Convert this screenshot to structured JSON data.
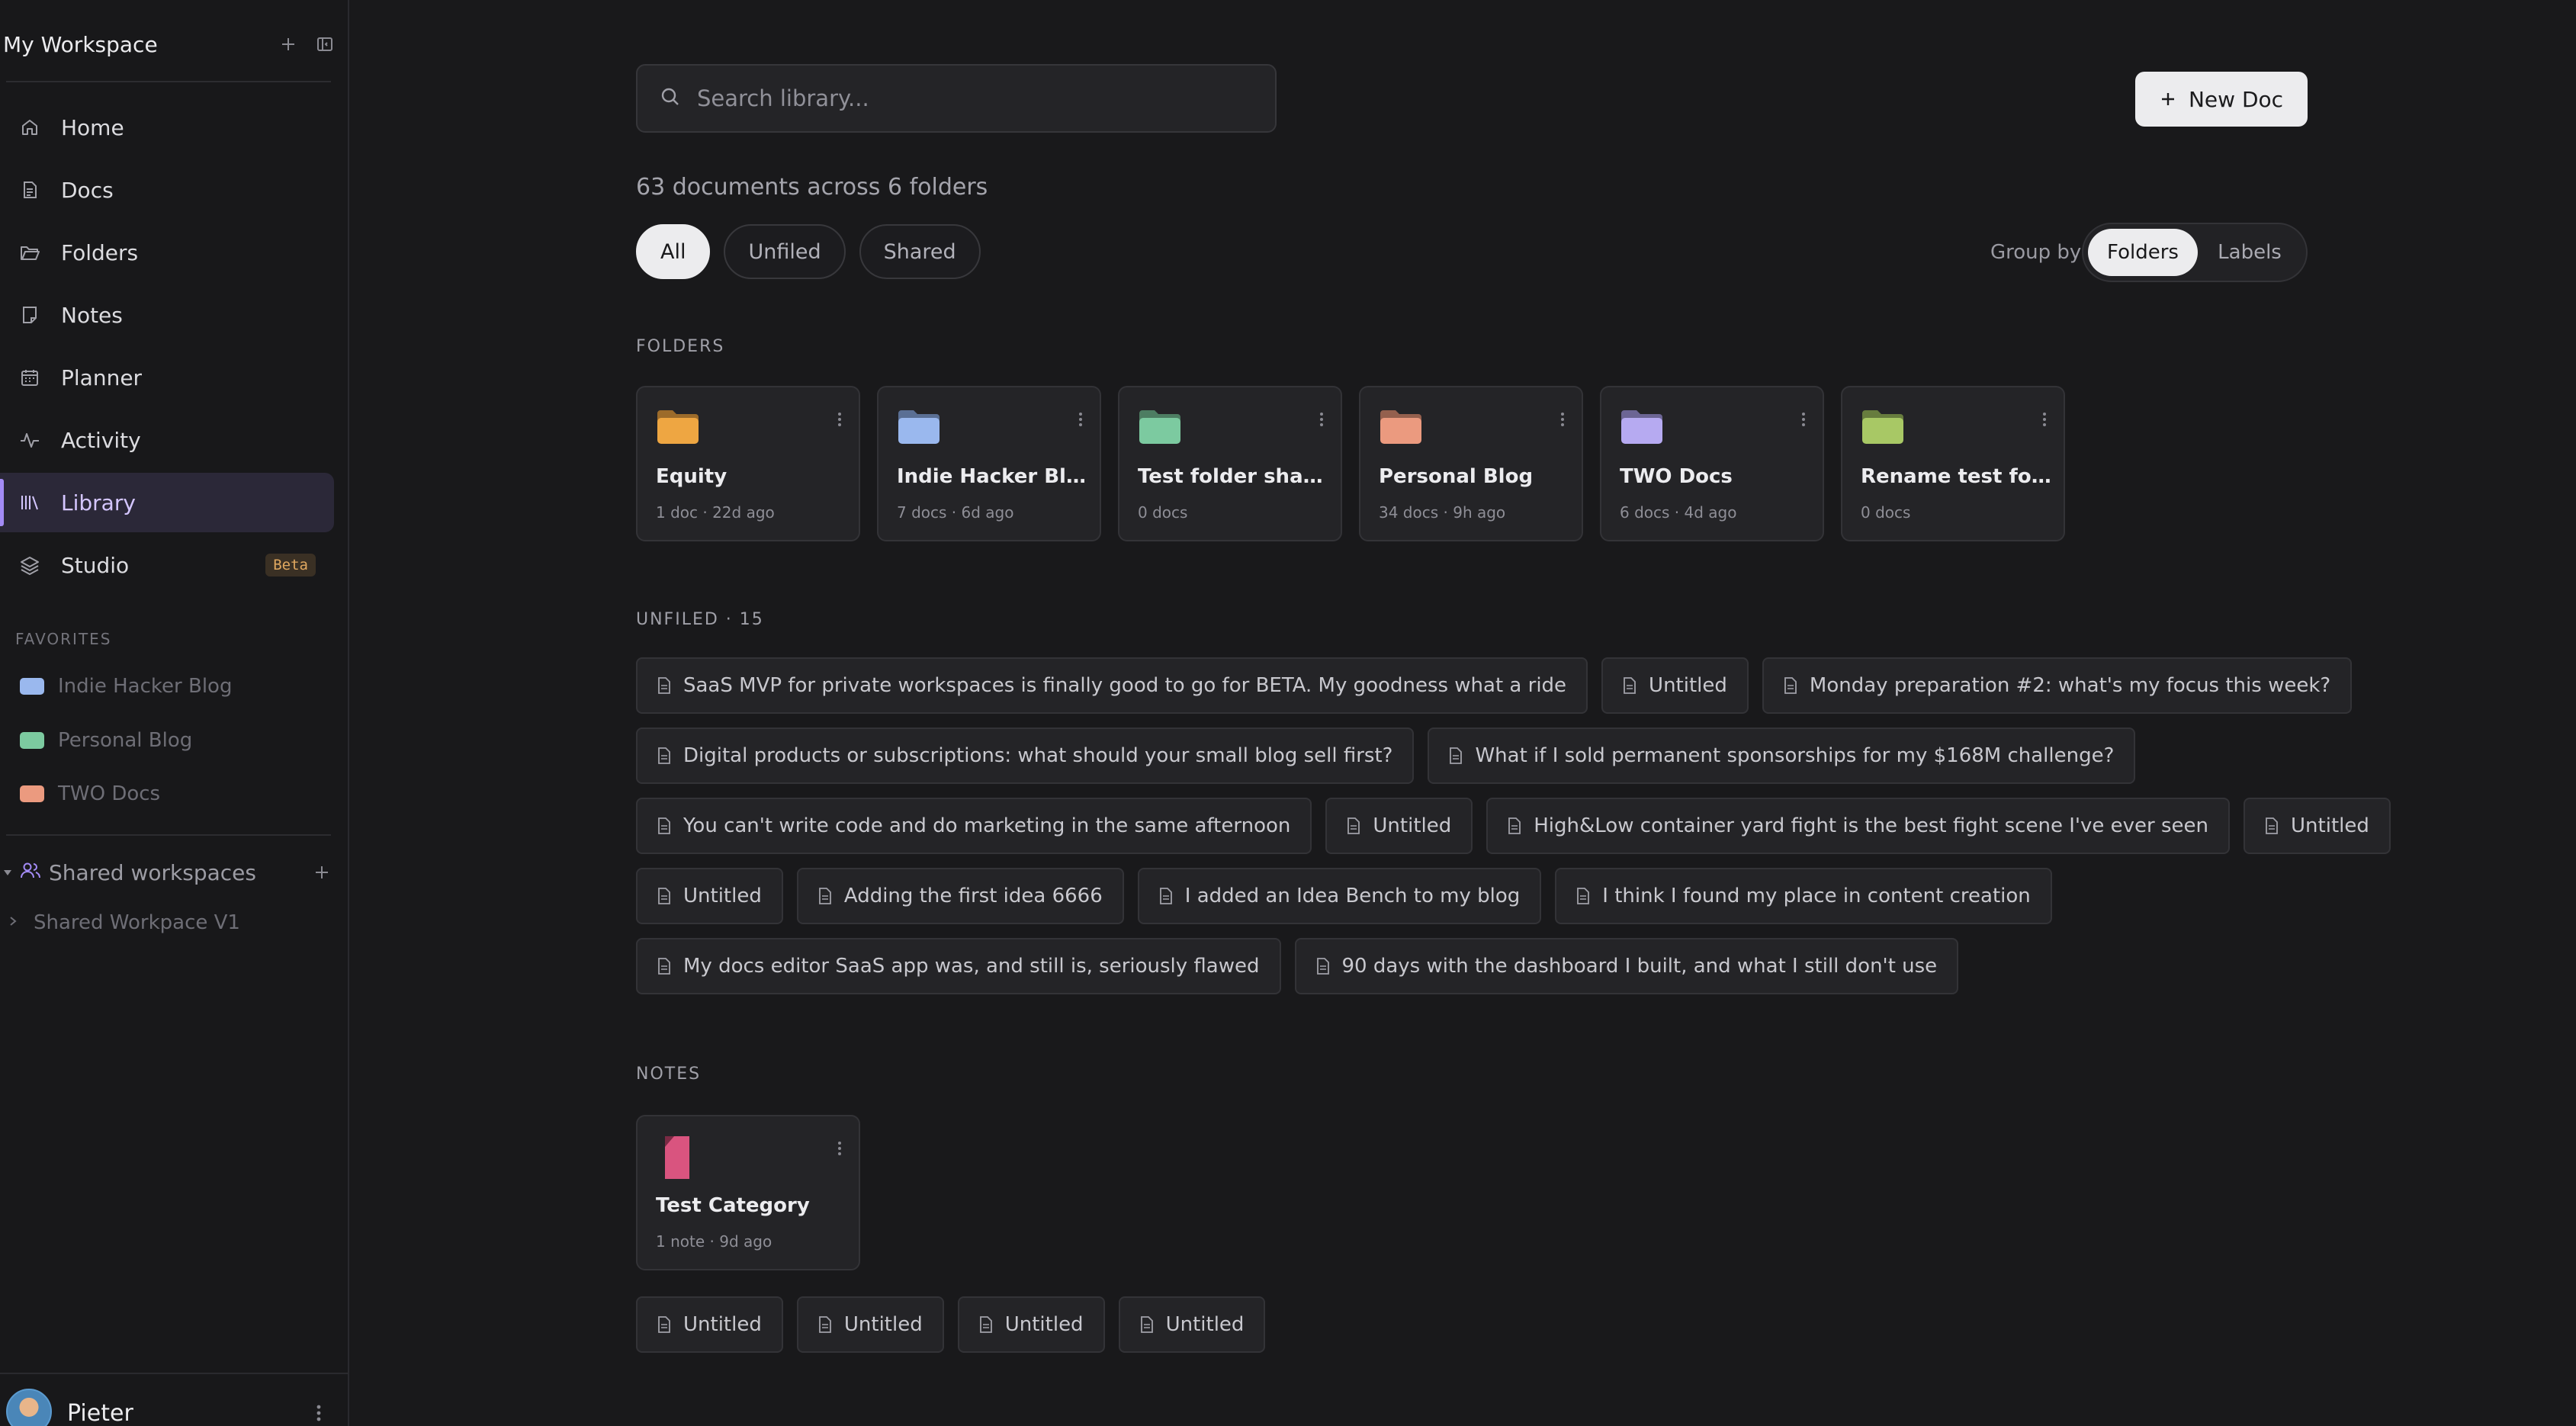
{
  "workspace": {
    "title": "My Workspace"
  },
  "nav": {
    "items": [
      {
        "label": "Home",
        "icon": "home-icon"
      },
      {
        "label": "Docs",
        "icon": "doc-icon"
      },
      {
        "label": "Folders",
        "icon": "folder-open-icon"
      },
      {
        "label": "Notes",
        "icon": "note-icon"
      },
      {
        "label": "Planner",
        "icon": "calendar-icon"
      },
      {
        "label": "Activity",
        "icon": "activity-icon"
      },
      {
        "label": "Library",
        "icon": "library-icon",
        "active": true
      },
      {
        "label": "Studio",
        "icon": "layers-icon",
        "badge": "Beta"
      }
    ]
  },
  "favorites": {
    "title": "FAVORITES",
    "items": [
      {
        "label": "Indie Hacker Blog",
        "color": "#9ab8ee"
      },
      {
        "label": "Personal Blog",
        "color": "#7ccaa0"
      },
      {
        "label": "TWO Docs",
        "color": "#eb9a7f"
      }
    ]
  },
  "shared": {
    "label": "Shared workspaces",
    "child": "Shared Workpace V1"
  },
  "user": {
    "name": "Pieter"
  },
  "search": {
    "placeholder": "Search library..."
  },
  "toolbar": {
    "new_doc_label": "New Doc"
  },
  "summary": "63 documents across 6 folders",
  "filters": [
    {
      "label": "All",
      "active": true
    },
    {
      "label": "Unfiled"
    },
    {
      "label": "Shared"
    }
  ],
  "group_by": {
    "label": "Group by",
    "options": [
      "Folders",
      "Labels"
    ],
    "selected": "Folders"
  },
  "folders": {
    "title": "FOLDERS",
    "items": [
      {
        "name": "Equity",
        "meta": "1 doc · 22d ago",
        "color": "#eea642",
        "tab": "#9c6b2a"
      },
      {
        "name": "Indie Hacker Blog",
        "meta": "7 docs · 6d ago",
        "color": "#9ab8ee",
        "tab": "#5a6f94"
      },
      {
        "name": "Test folder share...",
        "meta": "0 docs",
        "color": "#7ccaa0",
        "tab": "#4d7d62"
      },
      {
        "name": "Personal Blog",
        "meta": "34 docs · 9h ago",
        "color": "#eb9a7f",
        "tab": "#94604e"
      },
      {
        "name": "TWO Docs",
        "meta": "6 docs · 4d ago",
        "color": "#b6aaf1",
        "tab": "#6c6594"
      },
      {
        "name": "Rename test folder",
        "meta": "0 docs",
        "color": "#a8c865",
        "tab": "#677c3e"
      }
    ]
  },
  "unfiled": {
    "title": "UNFILED · 15",
    "rows": [
      [
        "SaaS MVP for private workspaces is finally good to go for BETA. My goodness what a ride",
        "Untitled",
        "Monday preparation #2: what's my focus this week?"
      ],
      [
        "Digital products or subscriptions: what should your small blog sell first?",
        "What if I sold permanent sponsorships for my $168M challenge?"
      ],
      [
        "You can't write code and do marketing in the same afternoon",
        "Untitled",
        "High&Low container yard fight is the best fight scene I've ever seen",
        "Untitled"
      ],
      [
        "Untitled",
        "Adding the first idea 6666",
        "I added an Idea Bench to my blog",
        "I think I found my place in content creation"
      ],
      [
        "My docs editor SaaS app was, and still is, seriously flawed",
        "90 days with the dashboard I built, and what I still don't use"
      ]
    ]
  },
  "notes": {
    "title": "NOTES",
    "category": {
      "name": "Test Category",
      "meta": "1 note · 9d ago",
      "color": "#d9547f"
    },
    "chips": [
      "Untitled",
      "Untitled",
      "Untitled",
      "Untitled"
    ]
  }
}
